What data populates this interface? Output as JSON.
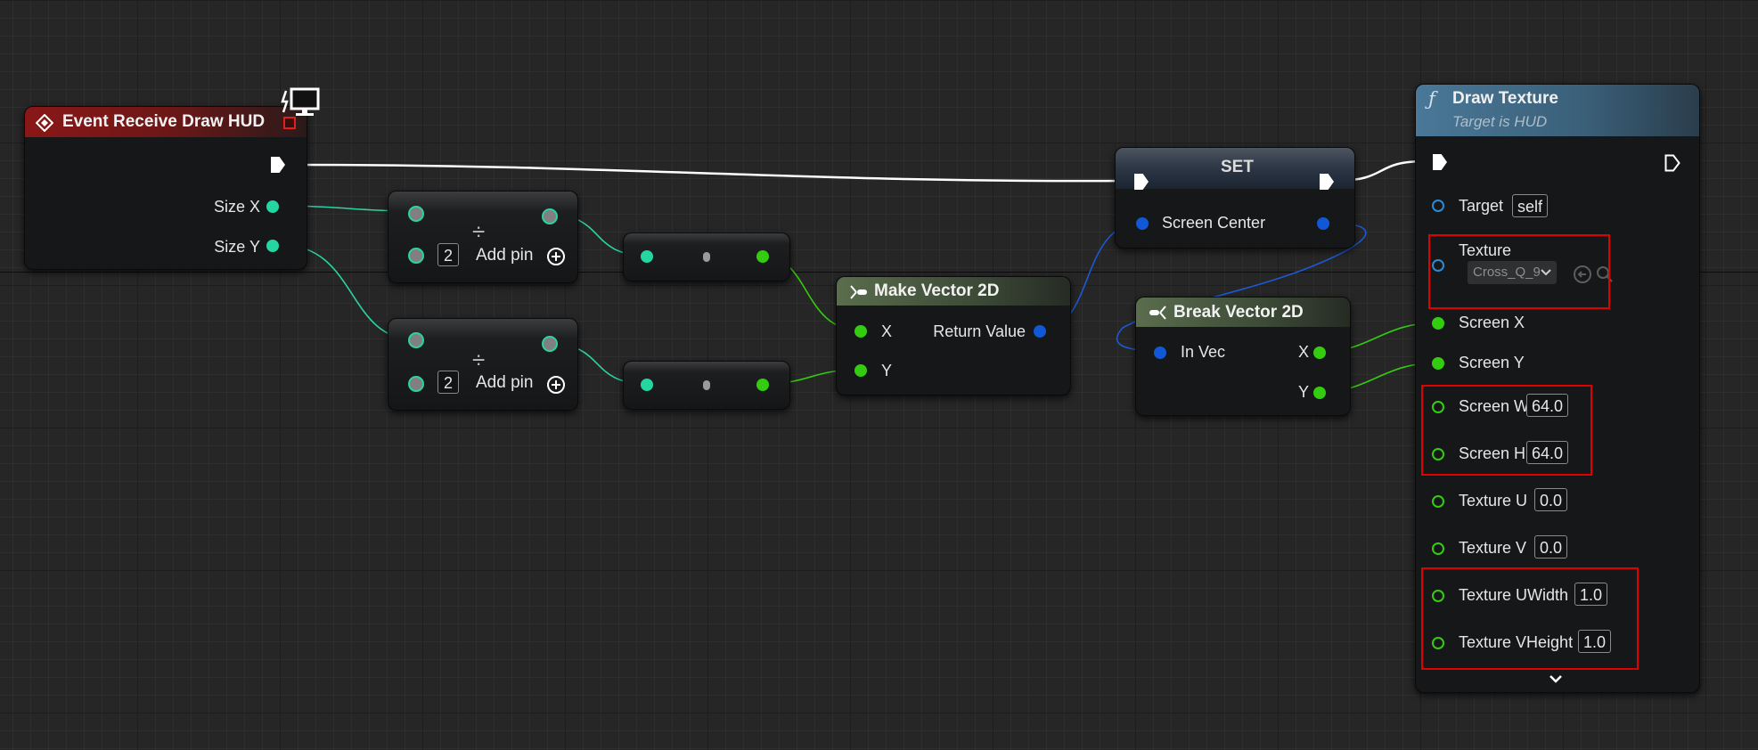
{
  "nodes": {
    "event_receive_draw_hud": {
      "title": "Event Receive Draw HUD",
      "pins": {
        "size_x": "Size X",
        "size_y": "Size Y"
      }
    },
    "divide_top": {
      "symbol": "÷",
      "b_value": "2",
      "add_pin": "Add pin"
    },
    "divide_bottom": {
      "symbol": "÷",
      "b_value": "2",
      "add_pin": "Add pin"
    },
    "make_vector_2d": {
      "title": "Make Vector 2D",
      "pins": {
        "x": "X",
        "y": "Y",
        "return_value": "Return Value"
      }
    },
    "set": {
      "title": "SET",
      "pins": {
        "screen_center": "Screen Center"
      }
    },
    "break_vector_2d": {
      "title": "Break Vector 2D",
      "pins": {
        "in_vec": "In Vec",
        "x": "X",
        "y": "Y"
      }
    },
    "draw_texture": {
      "title": "Draw Texture",
      "subtitle": "Target is HUD",
      "function_icon": "ƒ",
      "pins": {
        "target": {
          "label": "Target",
          "value": "self"
        },
        "texture": {
          "label": "Texture",
          "value": "Cross_Q_9"
        },
        "screen_x": {
          "label": "Screen X"
        },
        "screen_y": {
          "label": "Screen Y"
        },
        "screen_w": {
          "label": "Screen W",
          "value": "64.0"
        },
        "screen_h": {
          "label": "Screen H",
          "value": "64.0"
        },
        "texture_u": {
          "label": "Texture U",
          "value": "0.0"
        },
        "texture_v": {
          "label": "Texture V",
          "value": "0.0"
        },
        "texture_uwidth": {
          "label": "Texture UWidth",
          "value": "1.0"
        },
        "texture_vheight": {
          "label": "Texture VHeight",
          "value": "1.0"
        }
      }
    }
  },
  "colors": {
    "exec_wire": "#ffffff",
    "float_wire": "#2ad3a3",
    "double_wire": "#33cc11",
    "struct_wire": "#1a5ad6",
    "highlight": "#e00000",
    "event_header": "#8a1717",
    "pure_header": "#5a6d4d",
    "function_header": "#4a7898"
  },
  "icons": [
    "event-diamond-icon",
    "monitor-icon",
    "function-icon",
    "make-struct-icon",
    "break-struct-icon",
    "add-pin-icon",
    "browse-asset-icon",
    "search-asset-icon",
    "dropdown-chevron-icon",
    "expand-chevron-icon"
  ]
}
